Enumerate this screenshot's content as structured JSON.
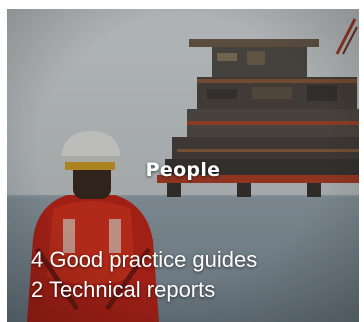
{
  "tile": {
    "title": "People",
    "stats": [
      "4 Good practice guides",
      "2 Technical reports"
    ],
    "colors": {
      "sky": "#d3d8da",
      "sea": "#8a9aa6",
      "platform": "#5a5048",
      "platform_accent": "#b0402a",
      "coverall": "#c4281c",
      "helmet": "#e6e6e3"
    }
  }
}
